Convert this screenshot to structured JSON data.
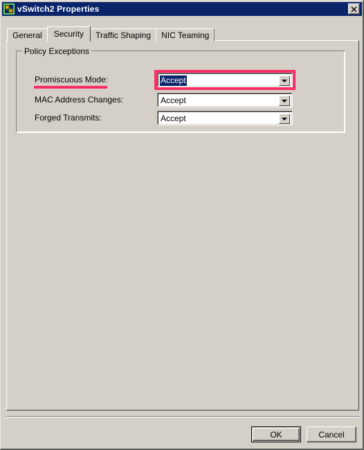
{
  "window": {
    "title": "vSwitch2 Properties",
    "icon": "vswitch-icon",
    "close_label": "✕",
    "titlebar_color": "#0a246a",
    "face_color": "#d4d0c8",
    "highlight_color": "#ff2e63"
  },
  "tabs": [
    {
      "label": "General",
      "active": false
    },
    {
      "label": "Security",
      "active": true
    },
    {
      "label": "Traffic Shaping",
      "active": false
    },
    {
      "label": "NIC Teaming",
      "active": false
    }
  ],
  "group": {
    "title": "Policy Exceptions",
    "rows": [
      {
        "label": "Promiscuous Mode:",
        "value": "Accept",
        "focused": true,
        "annotated": true,
        "underline_width": 106
      },
      {
        "label": "MAC Address Changes:",
        "value": "Accept",
        "focused": false,
        "annotated": false,
        "underline_width": 0
      },
      {
        "label": "Forged Transmits:",
        "value": "Accept",
        "focused": false,
        "annotated": false,
        "underline_width": 0
      }
    ]
  },
  "buttons": {
    "ok": "OK",
    "cancel": "Cancel"
  }
}
